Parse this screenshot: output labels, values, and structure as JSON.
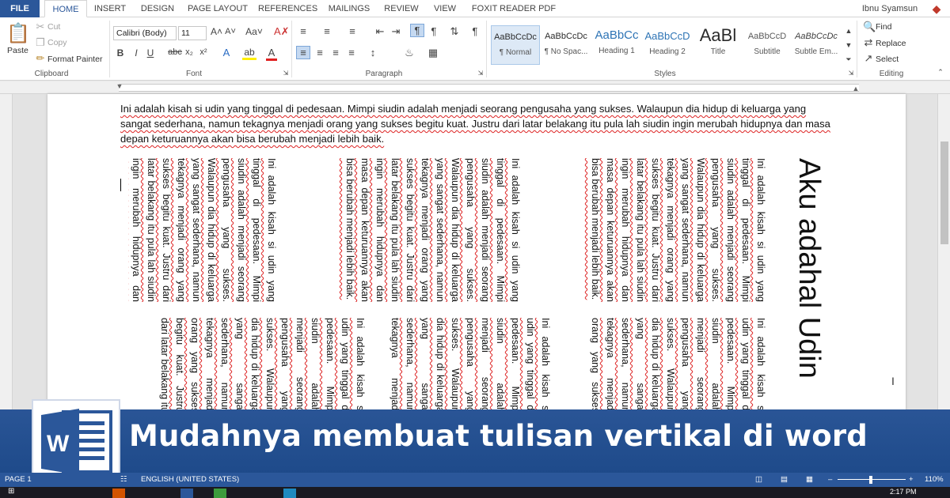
{
  "tabs": [
    "FILE",
    "HOME",
    "INSERT",
    "DESIGN",
    "PAGE LAYOUT",
    "REFERENCES",
    "MAILINGS",
    "REVIEW",
    "VIEW",
    "FOXIT READER PDF"
  ],
  "user": "Ibnu Syamsun",
  "clipboard": {
    "paste": "Paste",
    "cut": "Cut",
    "copy": "Copy",
    "format_painter": "Format Painter",
    "label": "Clipboard"
  },
  "font": {
    "name": "Calibri (Body)",
    "size": "11",
    "label": "Font"
  },
  "paragraph": {
    "label": "Paragraph"
  },
  "styles": {
    "label": "Styles",
    "items": [
      {
        "sample": "AaBbCcDc",
        "name": "¶ Normal"
      },
      {
        "sample": "AaBbCcDc",
        "name": "¶ No Spac..."
      },
      {
        "sample": "AaBbCc",
        "name": "Heading 1"
      },
      {
        "sample": "AaBbCcD",
        "name": "Heading 2"
      },
      {
        "sample": "AaBl",
        "name": "Title"
      },
      {
        "sample": "AaBbCcD",
        "name": "Subtitle"
      },
      {
        "sample": "AaBbCcDc",
        "name": "Subtle Em..."
      }
    ]
  },
  "editing": {
    "find": "Find",
    "replace": "Replace",
    "select": "Select",
    "label": "Editing"
  },
  "document": {
    "paragraph": "Ini adalah kisah si udin yang tinggal di pedesaan. Mimpi siudin adalah menjadi seorang pengusaha yang sukses. Walaupun dia hidup di keluarga yang sangat sederhana, namun tekagnya menjadi orang yang sukses begitu kuat. Justru dari latar belakang itu pula lah siudin ingin merubah hidupnya dan masa depan keturuannya akan bisa berubah menjadi lebih baik.",
    "vertical_title": "Aku adahal Udin"
  },
  "banner": {
    "title": "Mudahnya membuat tulisan vertikal di word"
  },
  "status": {
    "page": "PAGE 1",
    "language": "ENGLISH (UNITED STATES)",
    "zoom": "110%",
    "time": "2:17 PM"
  },
  "colors": {
    "word_blue": "#2b579a",
    "banner_blue": "#22508f"
  }
}
